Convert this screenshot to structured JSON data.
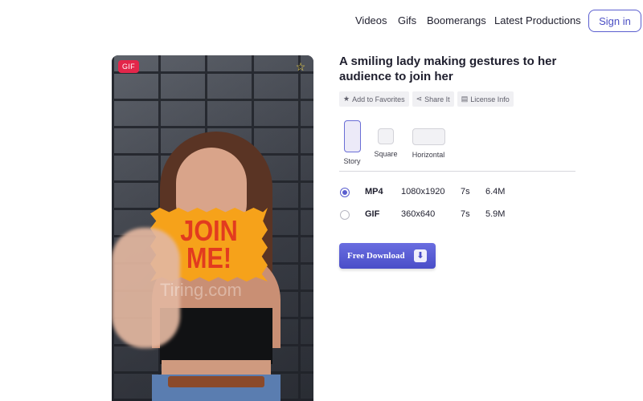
{
  "nav": {
    "links": [
      "Videos",
      "Gifs",
      "Boomerangs",
      "Latest Productions"
    ],
    "signin_label": "Sign in"
  },
  "media": {
    "badge": "GIF",
    "sign_line1": "JOIN",
    "sign_line2": "ME!",
    "watermark": "Tiring.com",
    "favorite_icon": "star-icon"
  },
  "details": {
    "title": "A smiling lady making gestures to her audience to join her",
    "actions": [
      {
        "label": "Add to Favorites",
        "icon": "star-icon"
      },
      {
        "label": "Share It",
        "icon": "share-icon"
      },
      {
        "label": "License Info",
        "icon": "document-icon"
      }
    ],
    "formats": [
      {
        "label": "Story",
        "selected": true
      },
      {
        "label": "Square",
        "selected": false
      },
      {
        "label": "Horizontal",
        "selected": false
      }
    ],
    "files": [
      {
        "format": "MP4",
        "resolution": "1080x1920",
        "duration": "7s",
        "size": "6.4M",
        "selected": true
      },
      {
        "format": "GIF",
        "resolution": "360x640",
        "duration": "7s",
        "size": "5.9M",
        "selected": false
      }
    ],
    "download_label": "Free Download",
    "download_icon": "download-icon"
  },
  "colors": {
    "accent": "#5a5ecf",
    "badge": "#e3264a"
  }
}
